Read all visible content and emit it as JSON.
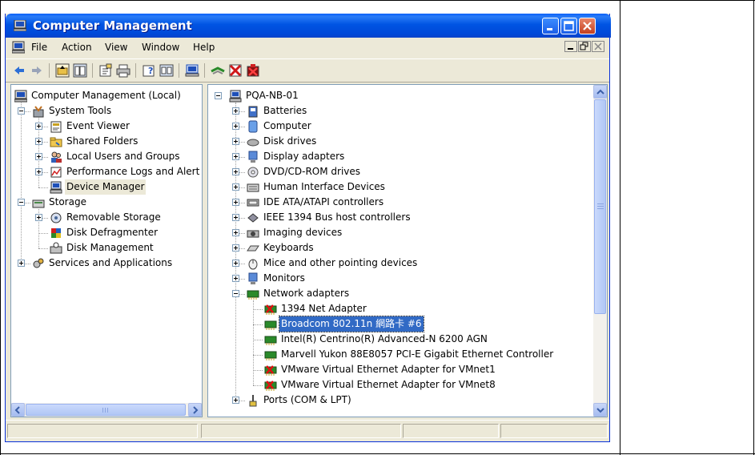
{
  "window": {
    "title": "Computer Management"
  },
  "menu": [
    "File",
    "Action",
    "View",
    "Window",
    "Help"
  ],
  "toolbar_icons": [
    "back-arrow-icon",
    "forward-arrow-icon",
    "up-folder-icon",
    "show-hide-tree-icon",
    "properties-icon",
    "print-icon",
    "help-icon",
    "export-list-icon",
    "scan-hardware-icon",
    "update-driver-icon",
    "disable-device-icon",
    "uninstall-device-icon"
  ],
  "left_tree": [
    {
      "label": "Computer Management (Local)",
      "icon": "computer-management-icon",
      "level": 0,
      "expander": "none"
    },
    {
      "label": "System Tools",
      "icon": "system-tools-icon",
      "level": 1,
      "expander": "minus"
    },
    {
      "label": "Event Viewer",
      "icon": "event-viewer-icon",
      "level": 2,
      "expander": "plus"
    },
    {
      "label": "Shared Folders",
      "icon": "shared-folders-icon",
      "level": 2,
      "expander": "plus"
    },
    {
      "label": "Local Users and Groups",
      "icon": "users-icon",
      "level": 2,
      "expander": "plus"
    },
    {
      "label": "Performance Logs and Alerts",
      "icon": "performance-icon",
      "level": 2,
      "expander": "plus"
    },
    {
      "label": "Device Manager",
      "icon": "device-manager-icon",
      "level": 2,
      "expander": "none",
      "selected": true
    },
    {
      "label": "Storage",
      "icon": "storage-icon",
      "level": 1,
      "expander": "minus"
    },
    {
      "label": "Removable Storage",
      "icon": "removable-storage-icon",
      "level": 2,
      "expander": "plus"
    },
    {
      "label": "Disk Defragmenter",
      "icon": "defrag-icon",
      "level": 2,
      "expander": "none"
    },
    {
      "label": "Disk Management",
      "icon": "disk-management-icon",
      "level": 2,
      "expander": "none"
    },
    {
      "label": "Services and Applications",
      "icon": "services-icon",
      "level": 1,
      "expander": "plus"
    }
  ],
  "device_tree": [
    {
      "label": "PQA-NB-01",
      "icon": "computer-icon",
      "level": 0,
      "expander": "minus"
    },
    {
      "label": "Batteries",
      "icon": "battery-icon",
      "level": 1,
      "expander": "plus"
    },
    {
      "label": "Computer",
      "icon": "computer-small-icon",
      "level": 1,
      "expander": "plus"
    },
    {
      "label": "Disk drives",
      "icon": "disk-drive-icon",
      "level": 1,
      "expander": "plus"
    },
    {
      "label": "Display adapters",
      "icon": "display-adapter-icon",
      "level": 1,
      "expander": "plus"
    },
    {
      "label": "DVD/CD-ROM drives",
      "icon": "dvd-icon",
      "level": 1,
      "expander": "plus"
    },
    {
      "label": "Human Interface Devices",
      "icon": "hid-icon",
      "level": 1,
      "expander": "plus"
    },
    {
      "label": "IDE ATA/ATAPI controllers",
      "icon": "ide-controller-icon",
      "level": 1,
      "expander": "plus"
    },
    {
      "label": "IEEE 1394 Bus host controllers",
      "icon": "ieee1394-icon",
      "level": 1,
      "expander": "plus"
    },
    {
      "label": "Imaging devices",
      "icon": "imaging-device-icon",
      "level": 1,
      "expander": "plus"
    },
    {
      "label": "Keyboards",
      "icon": "keyboard-icon",
      "level": 1,
      "expander": "plus"
    },
    {
      "label": "Mice and other pointing devices",
      "icon": "mouse-icon",
      "level": 1,
      "expander": "plus"
    },
    {
      "label": "Monitors",
      "icon": "monitor-icon",
      "level": 1,
      "expander": "plus"
    },
    {
      "label": "Network adapters",
      "icon": "network-adapter-icon",
      "level": 1,
      "expander": "minus"
    },
    {
      "label": "1394 Net Adapter",
      "icon": "network-card-disabled-icon",
      "level": 2,
      "expander": "none"
    },
    {
      "label": "Broadcom 802.11n 網路卡 #6",
      "icon": "network-card-icon",
      "level": 2,
      "expander": "none",
      "selected": true
    },
    {
      "label": "Intel(R) Centrino(R) Advanced-N 6200 AGN",
      "icon": "network-card-icon",
      "level": 2,
      "expander": "none"
    },
    {
      "label": "Marvell Yukon 88E8057 PCI-E Gigabit Ethernet Controller",
      "icon": "network-card-icon",
      "level": 2,
      "expander": "none"
    },
    {
      "label": "VMware Virtual Ethernet Adapter for VMnet1",
      "icon": "network-card-disabled-icon",
      "level": 2,
      "expander": "none"
    },
    {
      "label": "VMware Virtual Ethernet Adapter for VMnet8",
      "icon": "network-card-disabled-icon",
      "level": 2,
      "expander": "none"
    },
    {
      "label": "Ports (COM & LPT)",
      "icon": "port-icon",
      "level": 1,
      "expander": "plus"
    }
  ],
  "colors": {
    "title_blue": "#0054e3",
    "selection_blue": "#316ac5",
    "chrome": "#ece9d8"
  }
}
